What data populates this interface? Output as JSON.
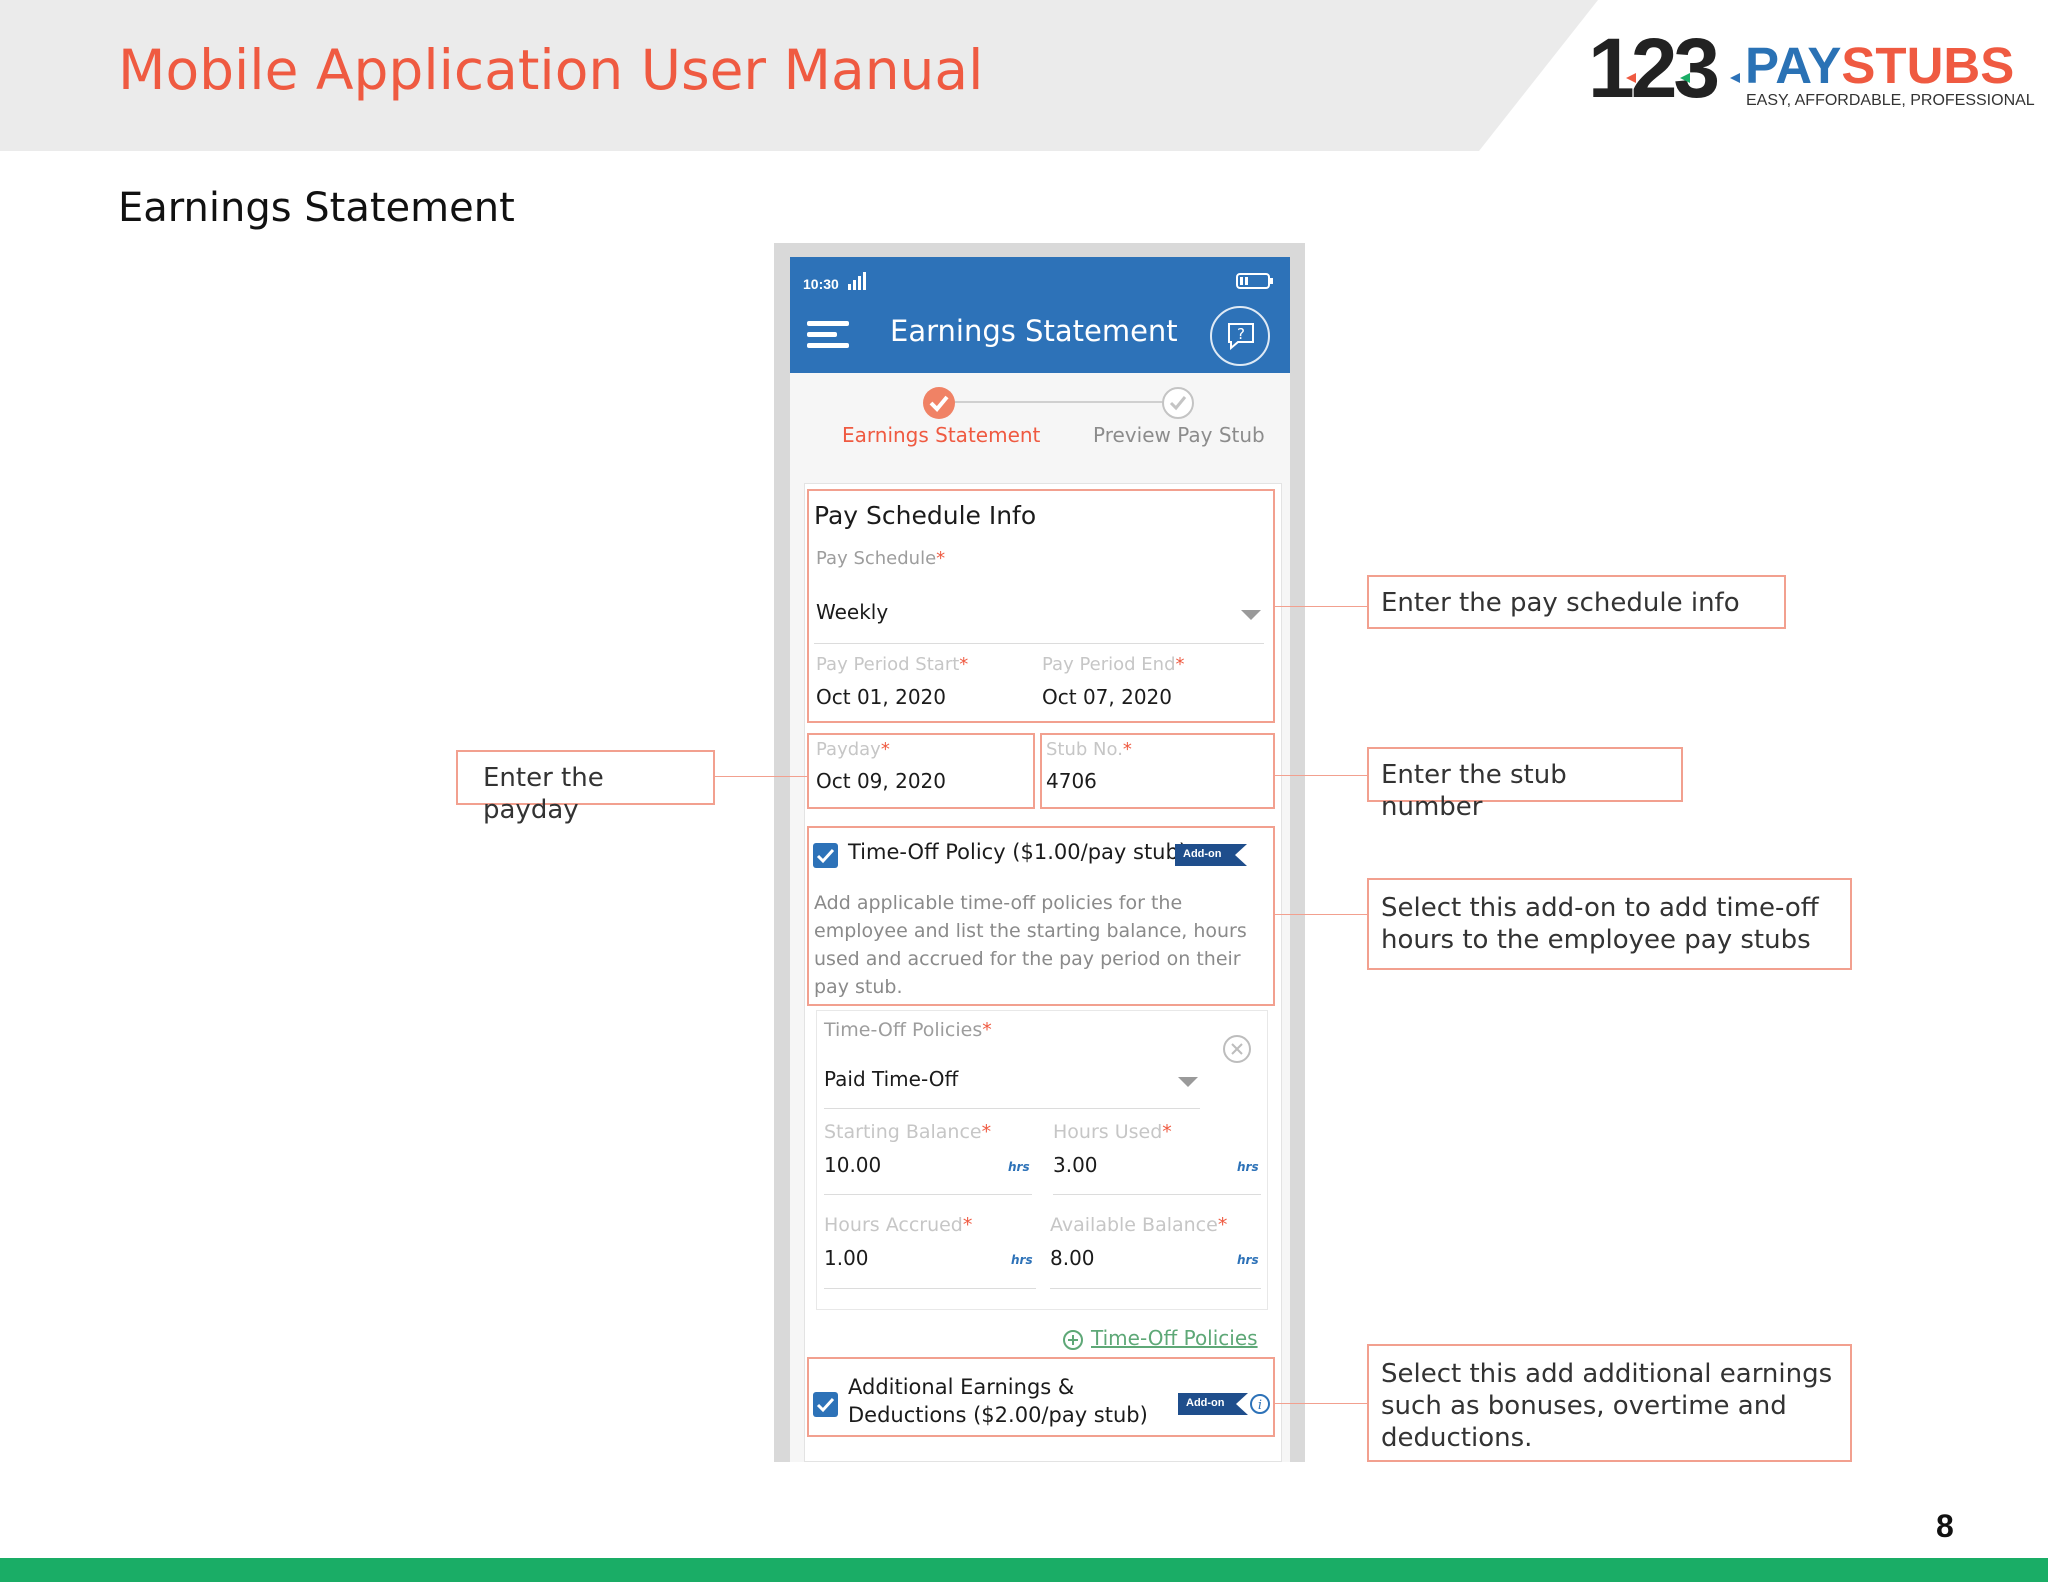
{
  "header": {
    "manual_title": "Mobile Application User Manual",
    "logo_number": "123",
    "logo_pay": "PAY",
    "logo_stubs": "STUBS",
    "logo_tagline": "EASY, AFFORDABLE, PROFESSIONAL"
  },
  "section_title": "Earnings Statement",
  "phone": {
    "status_time": "10:30",
    "appbar_title": "Earnings Statement",
    "steps": [
      {
        "label": "Earnings Statement",
        "state": "complete"
      },
      {
        "label": "Preview Pay Stub",
        "state": "pending"
      }
    ],
    "pay_schedule_info": {
      "heading": "Pay Schedule Info",
      "pay_schedule_label": "Pay Schedule",
      "pay_schedule_value": "Weekly",
      "period_start_label": "Pay Period Start",
      "period_start_value": "Oct 01, 2020",
      "period_end_label": "Pay Period End",
      "period_end_value": "Oct 07, 2020"
    },
    "payday": {
      "label": "Payday",
      "value": "Oct 09, 2020"
    },
    "stub_no": {
      "label": "Stub No.",
      "value": "4706"
    },
    "required_mark": "*",
    "time_off": {
      "checkbox_label": "Time-Off Policy ($1.00/pay stub)",
      "addon_badge": "Add-on",
      "description": "Add applicable time-off policies for the employee and list the starting balance, hours used and accrued for the pay period on their pay stub.",
      "policies_label": "Time-Off Policies",
      "policy_value": "Paid Time-Off",
      "starting_balance_label": "Starting Balance",
      "starting_balance_value": "10.00",
      "hours_used_label": "Hours Used",
      "hours_used_value": "3.00",
      "hours_accrued_label": "Hours Accrued",
      "hours_accrued_value": "1.00",
      "available_balance_label": "Available Balance",
      "available_balance_value": "8.00",
      "unit": "hrs",
      "add_link": "Time-Off Policies"
    },
    "additional_earnings": {
      "label_line1": "Additional Earnings &",
      "label_line2": "Deductions ($2.00/pay stub)",
      "addon_badge": "Add-on"
    }
  },
  "callouts": {
    "pay_schedule": "Enter the pay schedule info",
    "payday": "Enter the payday",
    "stub_number": "Enter the stub number",
    "time_off": "Select this add-on to add time-off hours to the employee pay stubs",
    "additional": "Select this add additional earnings such as bonuses, overtime and deductions."
  },
  "page_number": "8",
  "colors": {
    "brand_orange": "#ef5a41",
    "brand_blue": "#2d72b8",
    "footer_green": "#1aad66",
    "callout_border": "#f2a08f"
  },
  "icons": [
    "menu-icon",
    "help-chat-icon",
    "signal-icon",
    "battery-icon",
    "check-circle-icon",
    "dropdown-arrow-icon",
    "close-circle-icon",
    "plus-circle-icon",
    "info-icon",
    "checkbox-checked-icon"
  ]
}
